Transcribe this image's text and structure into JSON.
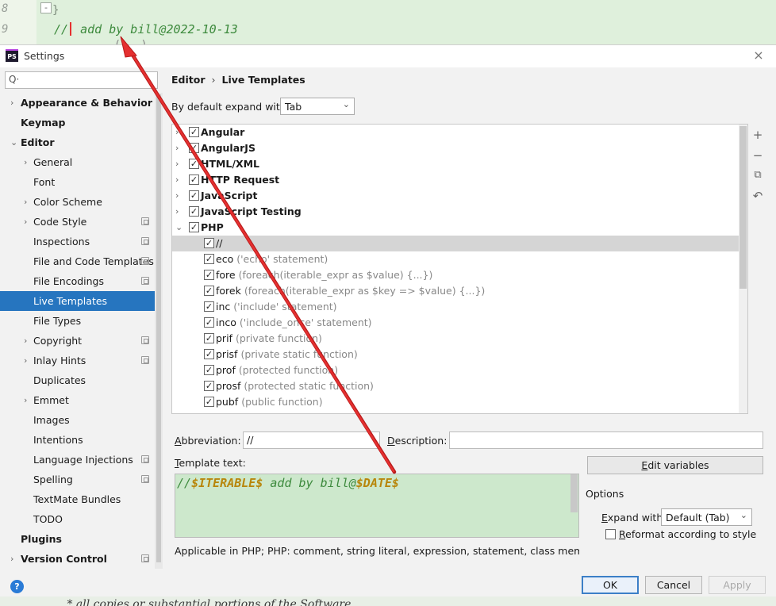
{
  "background_editor": {
    "line_numbers": [
      "8",
      "9"
    ],
    "brace": "}",
    "fold_marker": "-",
    "code_comment_prefix": "//",
    "code_comment_text": " add by bill@2022-10-13",
    "code_partial": "... (...)",
    "bottom_comment": " * all copies or substantial portions of the Software."
  },
  "window": {
    "app_icon": "PS",
    "title": "Settings",
    "close_icon": "×"
  },
  "sidebar": {
    "search_icon": "Q·",
    "search_placeholder": "",
    "items": [
      {
        "label": "Appearance & Behavior",
        "chevron": "›",
        "bold": true
      },
      {
        "label": "Keymap",
        "chevron": "",
        "bold": true
      },
      {
        "label": "Editor",
        "chevron": "⌄",
        "bold": true
      },
      {
        "label": "General",
        "chevron": "›"
      },
      {
        "label": "Font",
        "chevron": ""
      },
      {
        "label": "Color Scheme",
        "chevron": "›"
      },
      {
        "label": "Code Style",
        "chevron": "›",
        "config_icon": true
      },
      {
        "label": "Inspections",
        "chevron": "",
        "config_icon": true
      },
      {
        "label": "File and Code Templates",
        "chevron": "",
        "config_icon": true
      },
      {
        "label": "File Encodings",
        "chevron": "",
        "config_icon": true
      },
      {
        "label": "Live Templates",
        "chevron": "",
        "selected": true
      },
      {
        "label": "File Types",
        "chevron": ""
      },
      {
        "label": "Copyright",
        "chevron": "›",
        "config_icon": true
      },
      {
        "label": "Inlay Hints",
        "chevron": "›",
        "config_icon": true
      },
      {
        "label": "Duplicates",
        "chevron": ""
      },
      {
        "label": "Emmet",
        "chevron": "›"
      },
      {
        "label": "Images",
        "chevron": ""
      },
      {
        "label": "Intentions",
        "chevron": ""
      },
      {
        "label": "Language Injections",
        "chevron": "",
        "config_icon": true
      },
      {
        "label": "Spelling",
        "chevron": "",
        "config_icon": true
      },
      {
        "label": "TextMate Bundles",
        "chevron": ""
      },
      {
        "label": "TODO",
        "chevron": ""
      },
      {
        "label": "Plugins",
        "chevron": "",
        "bold": true
      },
      {
        "label": "Version Control",
        "chevron": "›",
        "bold": true,
        "config_icon": true
      }
    ]
  },
  "breadcrumb": {
    "parent": "Editor",
    "separator": "›",
    "current": "Live Templates"
  },
  "expand_default": {
    "label": "By default expand with",
    "value": "Tab",
    "arrow": "⌄"
  },
  "templates": {
    "groups_collapsed": [
      {
        "name": "Angular",
        "chevron": "›"
      },
      {
        "name": "AngularJS",
        "chevron": "›"
      },
      {
        "name": "HTML/XML",
        "chevron": "›"
      },
      {
        "name": "HTTP Request",
        "chevron": "›"
      },
      {
        "name": "JavaScript",
        "chevron": "›"
      },
      {
        "name": "JavaScript Testing",
        "chevron": "›"
      }
    ],
    "expanded_group": {
      "name": "PHP",
      "chevron": "⌄"
    },
    "check": "✓",
    "items": [
      {
        "abbr": "//",
        "desc": ""
      },
      {
        "abbr": "eco",
        "desc": "('echo' statement)"
      },
      {
        "abbr": "fore",
        "desc": "(foreach(iterable_expr as $value) {...})"
      },
      {
        "abbr": "forek",
        "desc": "(foreach(iterable_expr as $key => $value) {...})"
      },
      {
        "abbr": "inc",
        "desc": "('include' statement)"
      },
      {
        "abbr": "inco",
        "desc": "('include_once' statement)"
      },
      {
        "abbr": "prif",
        "desc": "(private function)"
      },
      {
        "abbr": "prisf",
        "desc": "(private static function)"
      },
      {
        "abbr": "prof",
        "desc": "(protected function)"
      },
      {
        "abbr": "prosf",
        "desc": "(protected static function)"
      },
      {
        "abbr": "pubf",
        "desc": "(public function)"
      }
    ]
  },
  "side_toolbar": {
    "add": "+",
    "remove": "−",
    "copy": "⧉",
    "restore": "↶"
  },
  "editor": {
    "abbreviation_label_first": "A",
    "abbreviation_label_rest": "bbreviation:",
    "abbreviation_value": "//",
    "description_label_first": "D",
    "description_label_rest": "escription:",
    "description_value": "",
    "template_text_label_first": "T",
    "template_text_label_rest": "emplate text:",
    "template_text_prefix": "//",
    "template_text_var1": "$ITERABLE$",
    "template_text_middle": " add by bill@",
    "template_text_var2": "$DATE$",
    "edit_variables_first": "E",
    "edit_variables_rest": "dit variables",
    "options_title": "Options",
    "expand_with_label_first": "E",
    "expand_with_label_rest": "xpand with",
    "expand_with_value": "Default (Tab)",
    "expand_with_arrow": "⌄",
    "reformat_first": "R",
    "reformat_rest": "eformat according to style",
    "applicable": "Applicable in PHP; PHP: comment, string literal, expression, statement, class member, interface"
  },
  "footer": {
    "help": "?",
    "ok": "OK",
    "cancel": "Cancel",
    "apply": "Apply"
  },
  "colors": {
    "selection": "#2675bf",
    "annotation_arrow": "#e02020",
    "template_bg": "#cde8cc"
  }
}
